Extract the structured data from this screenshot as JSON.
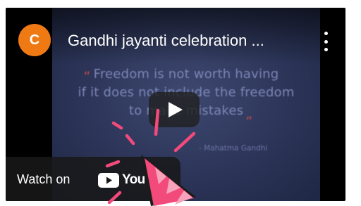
{
  "video": {
    "channel_initial": "C",
    "title": "Gandhi jayanti celebration ...",
    "menu_icon": "more-vert-icon",
    "play_icon": "play-icon"
  },
  "slide": {
    "quote_line_1": "Freedom is not worth having",
    "quote_line_2": "if it does not include the freedom",
    "quote_line_3": "to make mistakes",
    "open_quote": "“",
    "close_quote": "”",
    "author": "- Mahatma Gandhi"
  },
  "watch_on": {
    "label": "Watch on",
    "logo_text": "You"
  },
  "sticker": {
    "icon": "party-popper-icon"
  },
  "colors": {
    "avatar": "#ef7a14",
    "background": "#000000",
    "slide": "#2c3558",
    "quote_text": "#7c86b5",
    "quote_marks": "#c24a4a",
    "popper_pink": "#f24a7a"
  }
}
